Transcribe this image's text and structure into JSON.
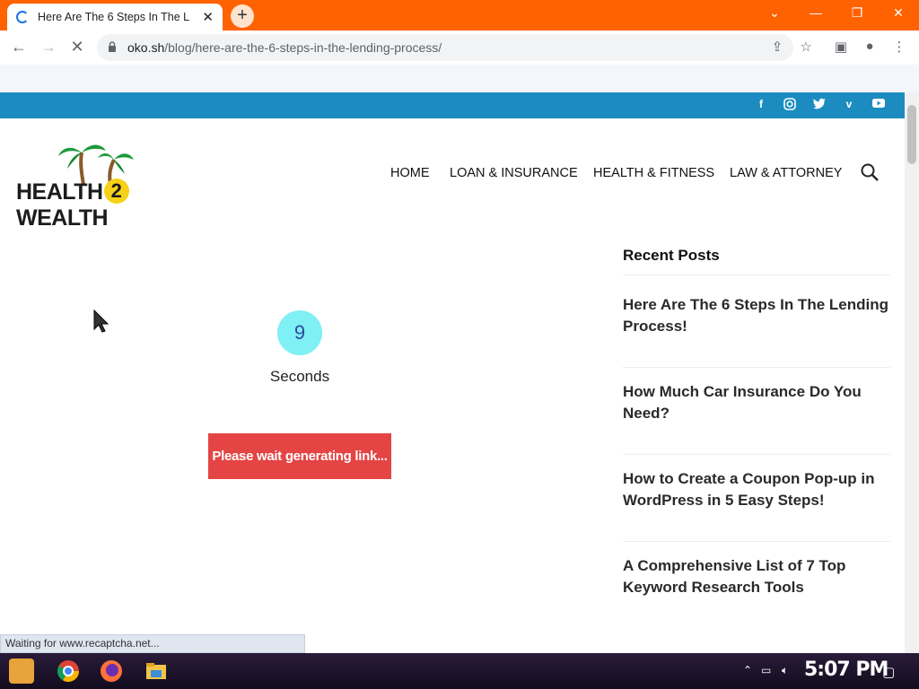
{
  "browser": {
    "tab_title": "Here Are The 6 Steps In The L",
    "tab_close": "✕",
    "new_tab": "+",
    "url_domain": "oko.sh",
    "url_path": "/blog/here-are-the-6-steps-in-the-lending-process/",
    "status_text": "Waiting for www.recaptcha.net..."
  },
  "site": {
    "logo_text_left": "HEALTH",
    "logo_text_num": "2",
    "logo_text_right": "WEALTH",
    "nav": [
      "HOME",
      "LOAN & INSURANCE",
      "HEALTH & FITNESS",
      "LAW & ATTORNEY"
    ],
    "social": [
      "facebook-icon",
      "instagram-icon",
      "twitter-icon",
      "vimeo-icon",
      "youtube-icon"
    ]
  },
  "main": {
    "countdown_value": "9",
    "countdown_unit": "Seconds",
    "wait_button": "Please wait generating link..."
  },
  "sidebar": {
    "heading": "Recent Posts",
    "posts": [
      "Here Are The 6 Steps In The Lending Process!",
      "How Much Car Insurance Do You Need?",
      "How to Create a Coupon Pop-up in WordPress in 5 Easy Steps!",
      "A Comprehensive List of 7 Top Keyword Research Tools"
    ]
  },
  "taskbar": {
    "clock": "5:07 PM"
  },
  "colors": {
    "titlebar": "#ff6200",
    "topbar": "#1c8cc0",
    "wait_button": "#e44444",
    "counter": "#7ff0f4"
  }
}
